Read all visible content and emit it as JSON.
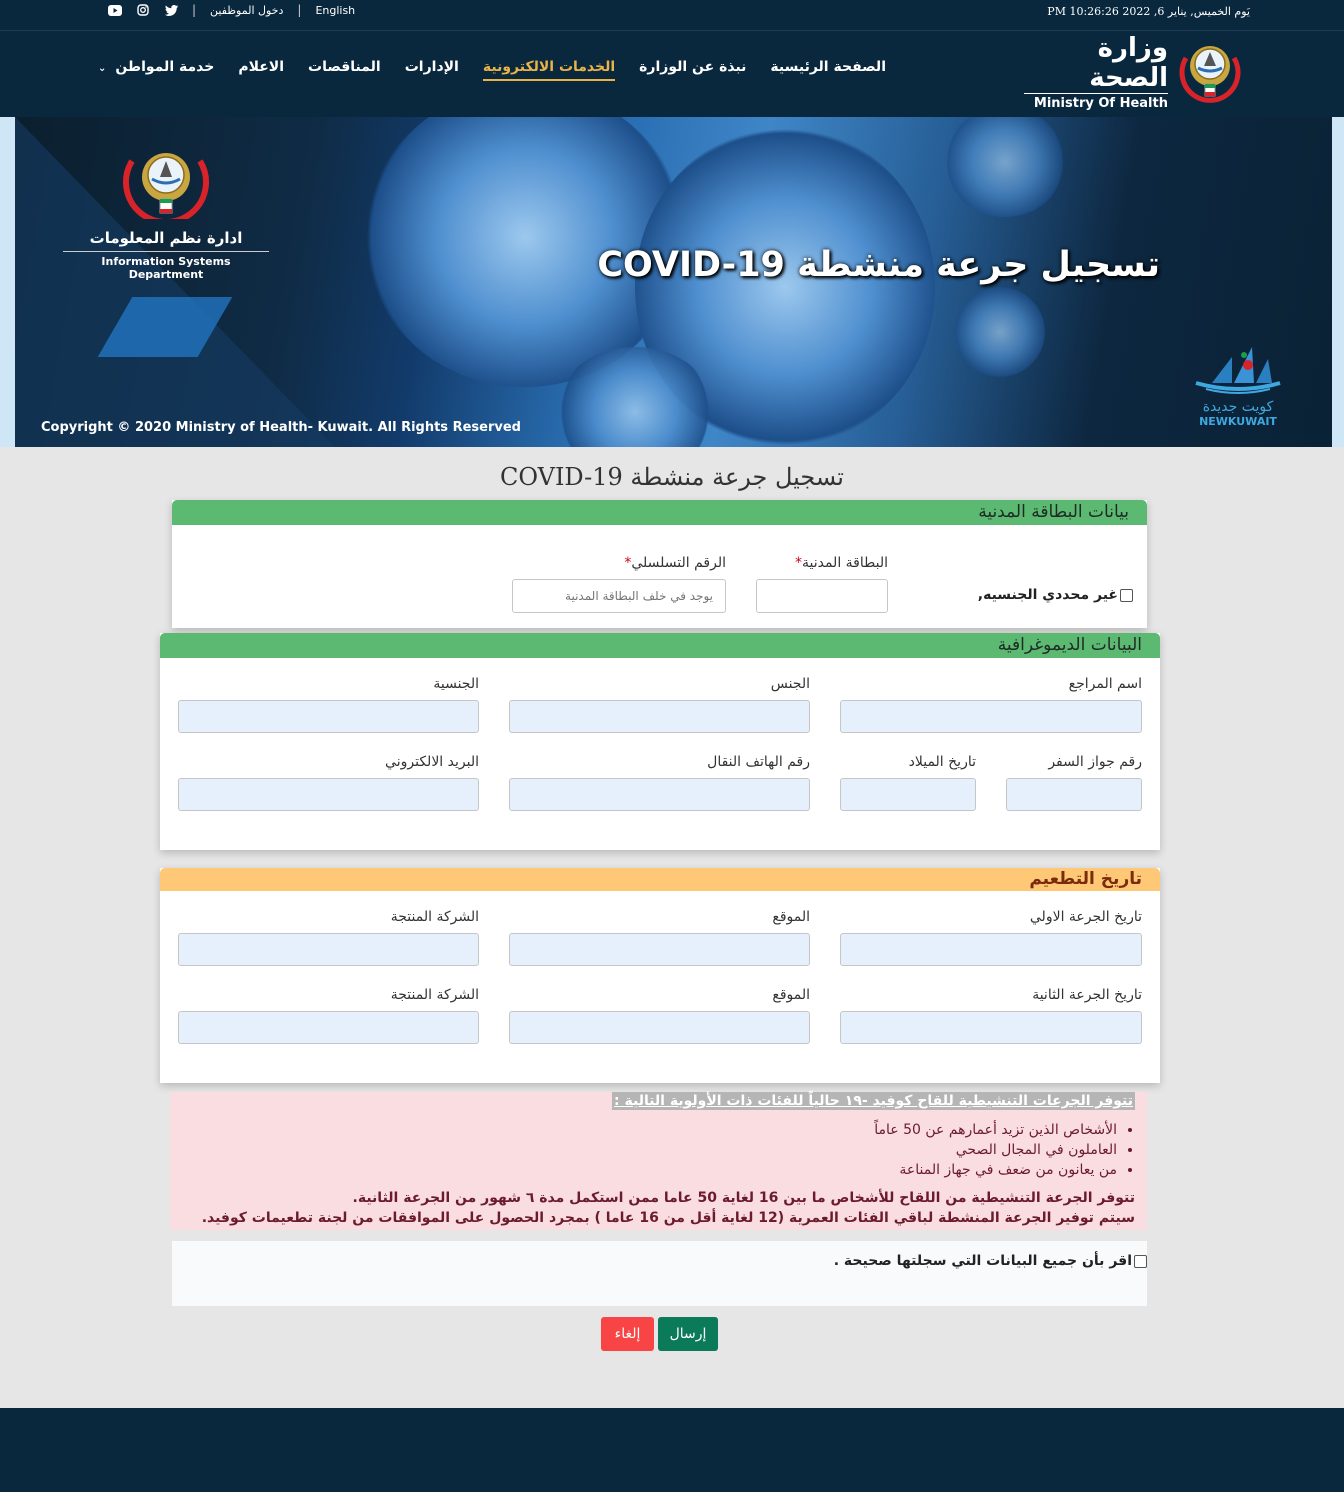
{
  "topbar": {
    "language_link": "English",
    "employee_login": "دخول الموظفين",
    "social": [
      "twitter-icon",
      "instagram-icon",
      "youtube-icon"
    ],
    "datetime": "يَوم الخميس, يناير 6, 2022 10:26:26 PM"
  },
  "logo": {
    "arabic": "وزارة الصحة",
    "english": "Ministry Of Health"
  },
  "nav": {
    "items": [
      {
        "label": "الصفحة الرئيسية",
        "active": false
      },
      {
        "label": "نبذة عن الوزارة",
        "active": false
      },
      {
        "label": "الخدمات الالكترونية",
        "active": true
      },
      {
        "label": "الإدارات",
        "active": false
      },
      {
        "label": "المناقصات",
        "active": false
      },
      {
        "label": "الاعلام",
        "active": false
      },
      {
        "label": "خدمة المواطن",
        "active": false,
        "dropdown": true
      }
    ]
  },
  "banner": {
    "department_ar": "ادارة نظم المعلومات",
    "department_en": "Information Systems Department",
    "title": "تسجيل جرعة منشطة COVID-19",
    "copyright": "Copyright © 2020 Ministry of Health- Kuwait. All Rights Reserved",
    "newkuwait_ar": "كويت جديدة",
    "newkuwait_en": "NEWKUWAIT"
  },
  "page": {
    "title": "تسجيل جرعة منشطة COVID-19"
  },
  "civil_card": {
    "header": "بيانات البطاقة المدنية",
    "stateless_label": "غير محددي الجنسيه,",
    "civil_id_label": "البطاقة المدنية",
    "civil_id_value": "",
    "serial_label": "الرقم التسلسلي",
    "serial_placeholder": "يوجد في خلف البطاقة المدنية",
    "required_mark": "*"
  },
  "demographics": {
    "header": "البيانات الديموغرافية",
    "fields": {
      "name": "اسم المراجع",
      "gender": "الجنس",
      "nationality": "الجنسية",
      "passport": "رقم جواز السفر",
      "birth_date": "تاريخ الميلاد",
      "mobile": "رقم الهاتف النقال",
      "email": "البريد الالكتروني"
    }
  },
  "vaccination": {
    "header": "تاريخ التطعيم",
    "fields": {
      "dose1_date": "تاريخ الجرعة الاولي",
      "dose1_location": "الموقع",
      "dose1_company": "الشركة المنتجة",
      "dose2_date": "تاريخ الجرعة الثانية",
      "dose2_location": "الموقع",
      "dose2_company": "الشركة المنتجة"
    }
  },
  "info": {
    "headline": "تتوفر الجرعات التنشيطية للقاح كوفيد -١٩ حالياً للفئات ذات الأولوية التالية :",
    "items": [
      "الأشخاص الذين تزيد أعمارهم عن 50 عاماً",
      "العاملون في المجال الصحي",
      "من يعانون من ضعف في جهاز المناعة"
    ],
    "note1": "تتوفر الجرعة التنشيطية من اللقاح للأشخاص ما بين 16 لغاية 50 عاما ممن استكمل مدة ٦ شهور من الجرعة الثانية.",
    "note2": "سيتم توفير الجرعة المنشطة لباقي الفئات العمرية (12 لغاية أقل من 16 عاما ) بمجرد الحصول على الموافقات من لجنة تطعيمات كوفيد."
  },
  "confirm": {
    "label": "اقر بأن جميع البيانات التي سجلتها صحيحة ."
  },
  "buttons": {
    "submit": "إرسال",
    "cancel": "إلغاء"
  },
  "colors": {
    "header_bg": "#0a283d",
    "nav_active": "#e8b447",
    "section_green": "#5cb971",
    "section_orange": "#fec876",
    "submit": "#0b7a58",
    "cancel": "#f84444",
    "info_bg": "#fadde1"
  }
}
